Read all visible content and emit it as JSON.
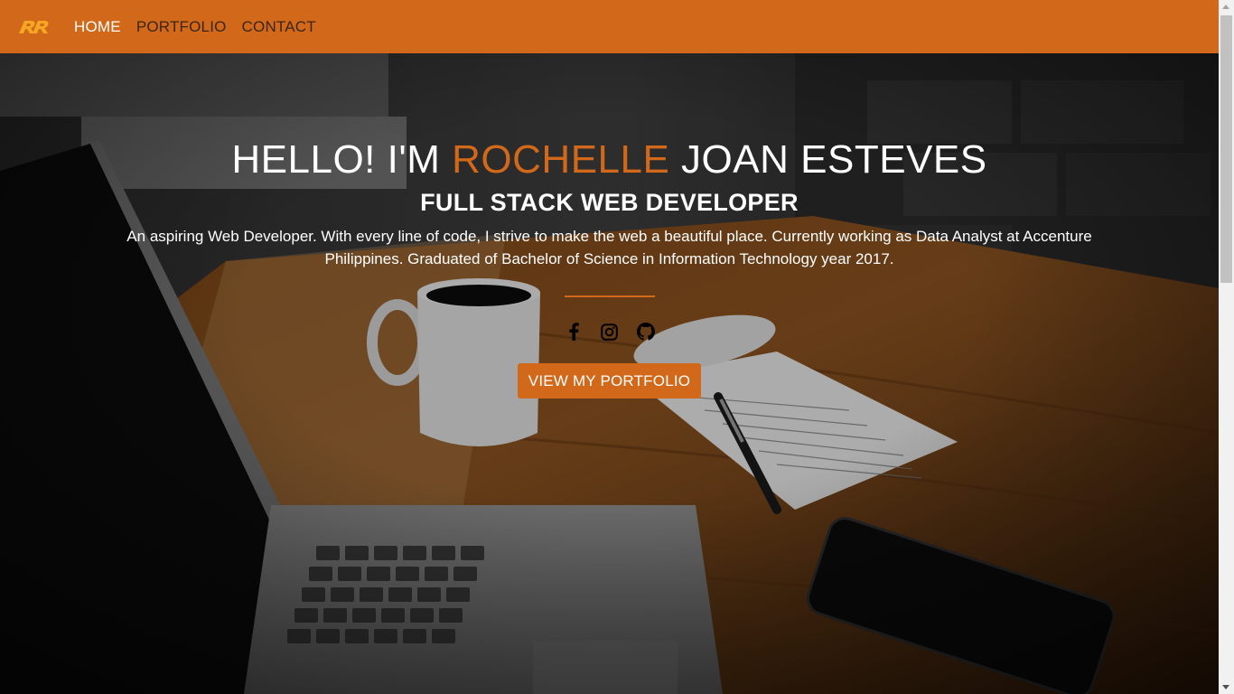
{
  "nav": {
    "logo_text": "RR",
    "links": [
      {
        "label": "HOME",
        "active": true
      },
      {
        "label": "PORTFOLIO",
        "active": false
      },
      {
        "label": "CONTACT",
        "active": false
      }
    ]
  },
  "hero": {
    "title_prefix": "HELLO! I'M ",
    "title_accent": "ROCHELLE",
    "title_suffix": " JOAN ESTEVES",
    "subtitle": "FULL STACK WEB DEVELOPER",
    "description": "An aspiring Web Developer. With every line of code, I strive to make the web a beautiful place. Currently working as Data Analyst at Accenture Philippines. Graduated of Bachelor of Science in Information Technology year 2017.",
    "social": [
      "facebook-icon",
      "instagram-icon",
      "github-icon"
    ],
    "cta_label": "VIEW MY PORTFOLIO"
  },
  "colors": {
    "accent": "#D2691A",
    "nav_text": "#3b2516",
    "text": "#ffffff"
  }
}
